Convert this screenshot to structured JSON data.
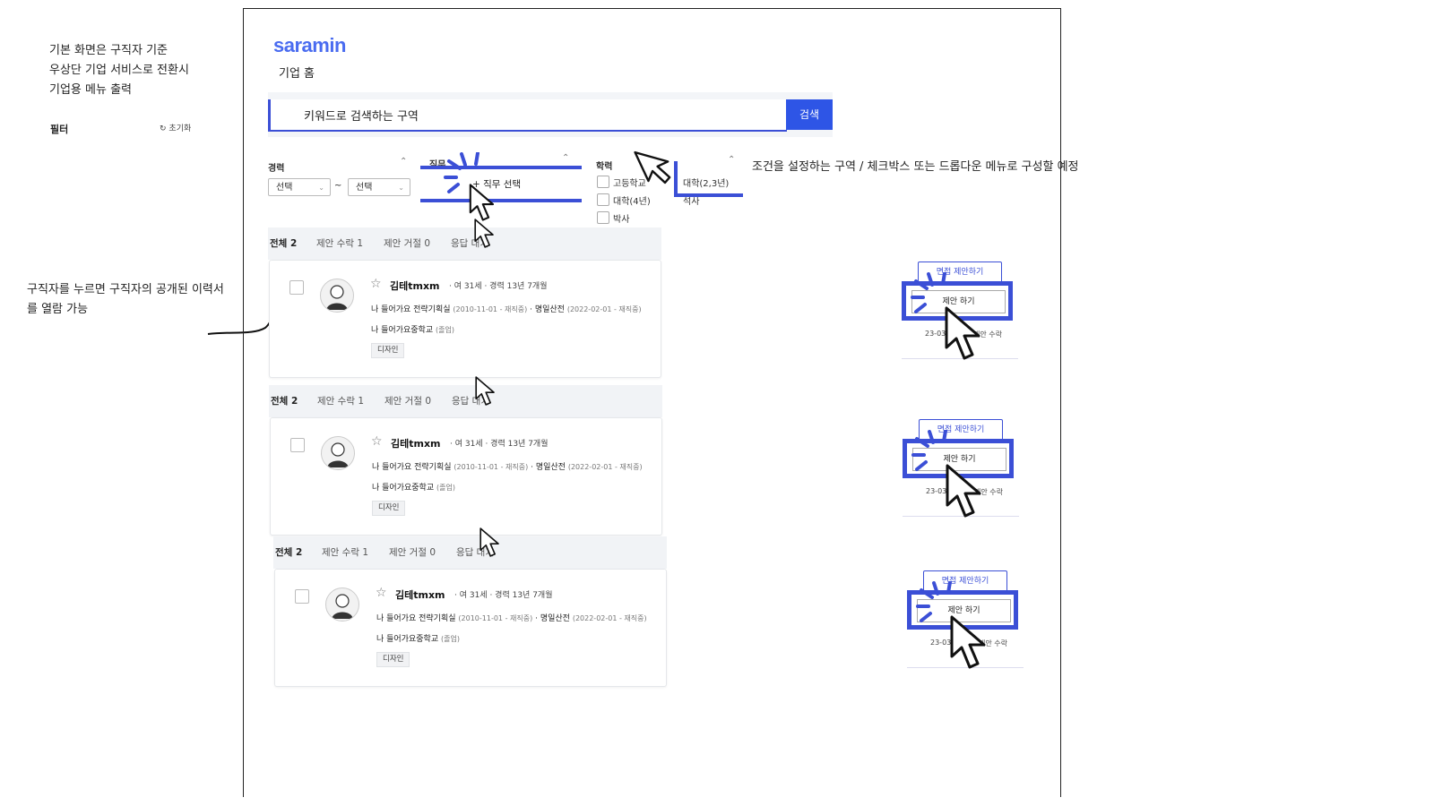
{
  "notes": {
    "top_left": [
      "기본 화면은 구직자 기준",
      "우상단 기업 서비스로 전환시",
      "기업용 메뉴 출력"
    ],
    "filter": "필터",
    "reset": "초기화",
    "resume_hint": [
      "구직자를 누르면 구직자의 공개된 이력서",
      "를 열람 가능"
    ],
    "condition_hint": "조건을 설정하는 구역 / 체크박스 또는 드롭다운 메뉴로 구성할 예정"
  },
  "header": {
    "logo": "saramin",
    "subtitle": "기업 홈"
  },
  "search": {
    "placeholder": "키워드로 검색하는 구역",
    "button": "검색"
  },
  "filters": {
    "career": {
      "label": "경력",
      "from": "선택",
      "tilde": "~",
      "to": "선택"
    },
    "job": {
      "label": "직무",
      "button": "+ 직무 선택"
    },
    "education": {
      "label": "학력",
      "options": [
        "고등학교",
        "대학(4년)",
        "박사"
      ],
      "options_right": [
        "대학(2,3년)",
        "석사"
      ]
    }
  },
  "tabs": {
    "all": "전체 2",
    "accepted": "제안 수락 1",
    "rejected": "제안 거절 0",
    "pending": "응답 대기"
  },
  "candidates": [
    {
      "name": "김테tmxm",
      "meta": "· 여 31세 · 경력 13년 7개월",
      "career1": "나 들어가요 전략기획실",
      "career1_period": "(2010-11-01 - 재직중)",
      "career2": "명일산전",
      "career2_period": "(2022-02-01 - 재직중)",
      "school": "나 들어가요중학교",
      "school_status": "(졸업)",
      "tag": "디자인",
      "interview_btn": "면접 제안하기",
      "propose_btn": "제안 하기",
      "date": "23-03-",
      "accepted": "제안 수락"
    },
    {
      "name": "김테tmxm",
      "meta": "· 여 31세 · 경력 13년 7개월",
      "career1": "나 들어가요 전략기획실",
      "career1_period": "(2010-11-01 - 재직중)",
      "career2": "명일산전",
      "career2_period": "(2022-02-01 - 재직중)",
      "school": "나 들어가요중학교",
      "school_status": "(졸업)",
      "tag": "디자인",
      "interview_btn": "면접 제안하기",
      "propose_btn": "제안 하기",
      "date": "23-03-",
      "accepted": "제안 수락"
    },
    {
      "name": "김테tmxm",
      "meta": "· 여 31세 · 경력 13년 7개월",
      "career1": "나 들어가요 전략기획실",
      "career1_period": "(2010-11-01 - 재직중)",
      "career2": "명일산전",
      "career2_period": "(2022-02-01 - 재직중)",
      "school": "나 들어가요중학교",
      "school_status": "(졸업)",
      "tag": "디자인",
      "interview_btn": "면접 제안하기",
      "propose_btn": "제안 하기",
      "date": "23-03-",
      "accepted": "제안 수락"
    }
  ],
  "colors": {
    "accent": "#3b4fd6",
    "brand": "#4a6cf0",
    "search_button": "#2e55e6"
  }
}
